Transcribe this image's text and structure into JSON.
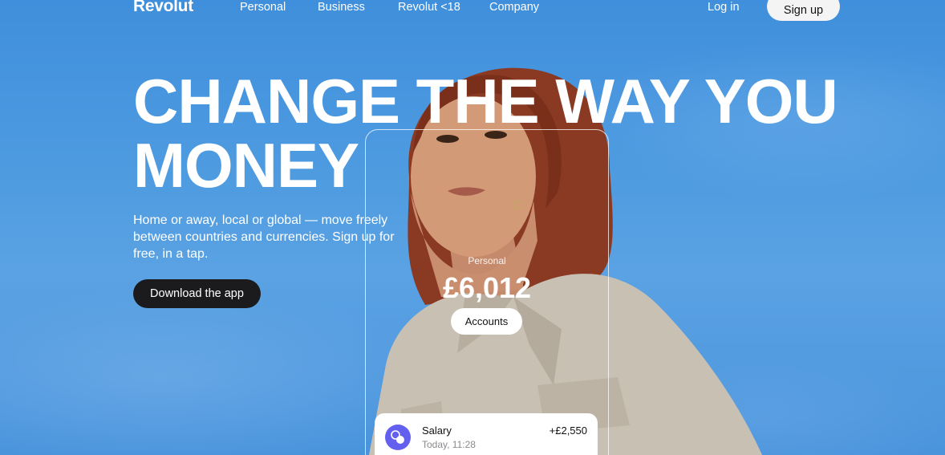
{
  "brand": {
    "logo": "Revolut"
  },
  "nav": {
    "links": [
      "Personal",
      "Business",
      "Revolut <18",
      "Company"
    ],
    "login": "Log in",
    "signup": "Sign up"
  },
  "hero": {
    "headline_line1": "CHANGE THE WAY YOU",
    "headline_line2": "MONEY",
    "subtext": "Home or away, local or global — move freely between countries and currencies. Sign up for free, in a tap.",
    "cta": "Download the app"
  },
  "phone": {
    "account_type": "Personal",
    "balance": "£6,012",
    "accounts_button": "Accounts",
    "transaction": {
      "icon": "coins-icon",
      "title": "Salary",
      "time": "Today, 11:28",
      "amount": "+£2,550"
    }
  },
  "colors": {
    "sky": "#4d9ae0",
    "dark_button": "#1b1b1d",
    "accent_icon": "#6360f0"
  }
}
